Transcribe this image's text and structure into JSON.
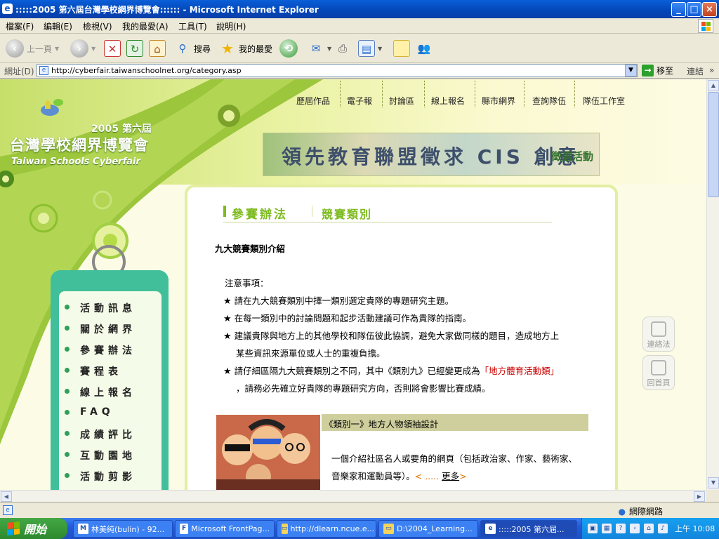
{
  "window": {
    "title": ":::::2005 第六屆台灣學校網界博覽會:::::: - Microsoft Internet Explorer",
    "minimize": "_",
    "maximize": "□",
    "close": "×"
  },
  "menu": [
    "檔案(F)",
    "編輯(E)",
    "檢視(V)",
    "我的最愛(A)",
    "工具(T)",
    "說明(H)"
  ],
  "toolbar": {
    "back": "上一頁",
    "search": "搜尋",
    "favorites": "我的最愛"
  },
  "address": {
    "label": "網址(D)",
    "url": "http://cyberfair.taiwanschoolnet.org/category.asp",
    "go": "移至",
    "links": "連結"
  },
  "page": {
    "logo": {
      "edition": "2005 第六屆",
      "title": "台灣學校網界博覽會",
      "english": "Taiwan Schools Cyberfair"
    },
    "topnav": [
      "歷屆作品",
      "電子報",
      "討論區",
      "線上報名",
      "縣市網界",
      "查詢隊伍",
      "隊伍工作室"
    ],
    "banner": {
      "text": "領先教育聯盟徵求 CIS 創意",
      "sub": "徵選活動"
    },
    "sidenav": [
      "活動訊息",
      "關於網界",
      "參賽辦法",
      "賽程表",
      "線上報名",
      "FAQ",
      "成績評比",
      "互動園地",
      "活動剪影"
    ],
    "breadcrumb": {
      "section": "參賽辦法",
      "sub": "競賽類別"
    },
    "heading": "九大競賽類別介紹",
    "notice_title": "注意事項：",
    "notices": [
      "請在九大競賽類別中擇一類別選定貴隊的專題研究主題。",
      "在每一類別中的討論問題和起步活動建議可作為貴隊的指南。",
      "建議貴隊與地方上的其他學校和隊伍彼此協調，避免大家做同樣的題目，造成地方上",
      "某些資訊來源單位或人士的重複負擔。",
      "請仔細區隔九大競賽類別之不同，其中《類別九》已經變更成為",
      "「地方體育活動類」",
      "，請務必先確立好貴隊的專題研究方向，否則將會影響比賽成績。"
    ],
    "category1": {
      "title": "《類別一》地方人物領袖設計",
      "desc1": "一個介紹社區名人或要角的網頁（包括政治家、作家、藝術家、",
      "desc2": "音樂家和運動員等）。",
      "more_prefix": "< .....",
      "more": "更多",
      "more_suffix": ">"
    },
    "float": {
      "contact": "連絡法",
      "home": "回首頁"
    }
  },
  "status": {
    "zone": "網際網路"
  },
  "taskbar": {
    "start": "開始",
    "tasks": [
      "林美純(bulin) - 92...",
      "Microsoft FrontPag...",
      "http://dlearn.ncue.e...",
      "D:\\2004_Learning...",
      ":::::2005 第六屆..."
    ],
    "clock": "上午 10:08"
  },
  "colors": {
    "accent_green": "#7dbb1f",
    "teal_panel": "#40bf9a",
    "highlight_red": "#cc0000",
    "link_orange": "#e07000"
  }
}
